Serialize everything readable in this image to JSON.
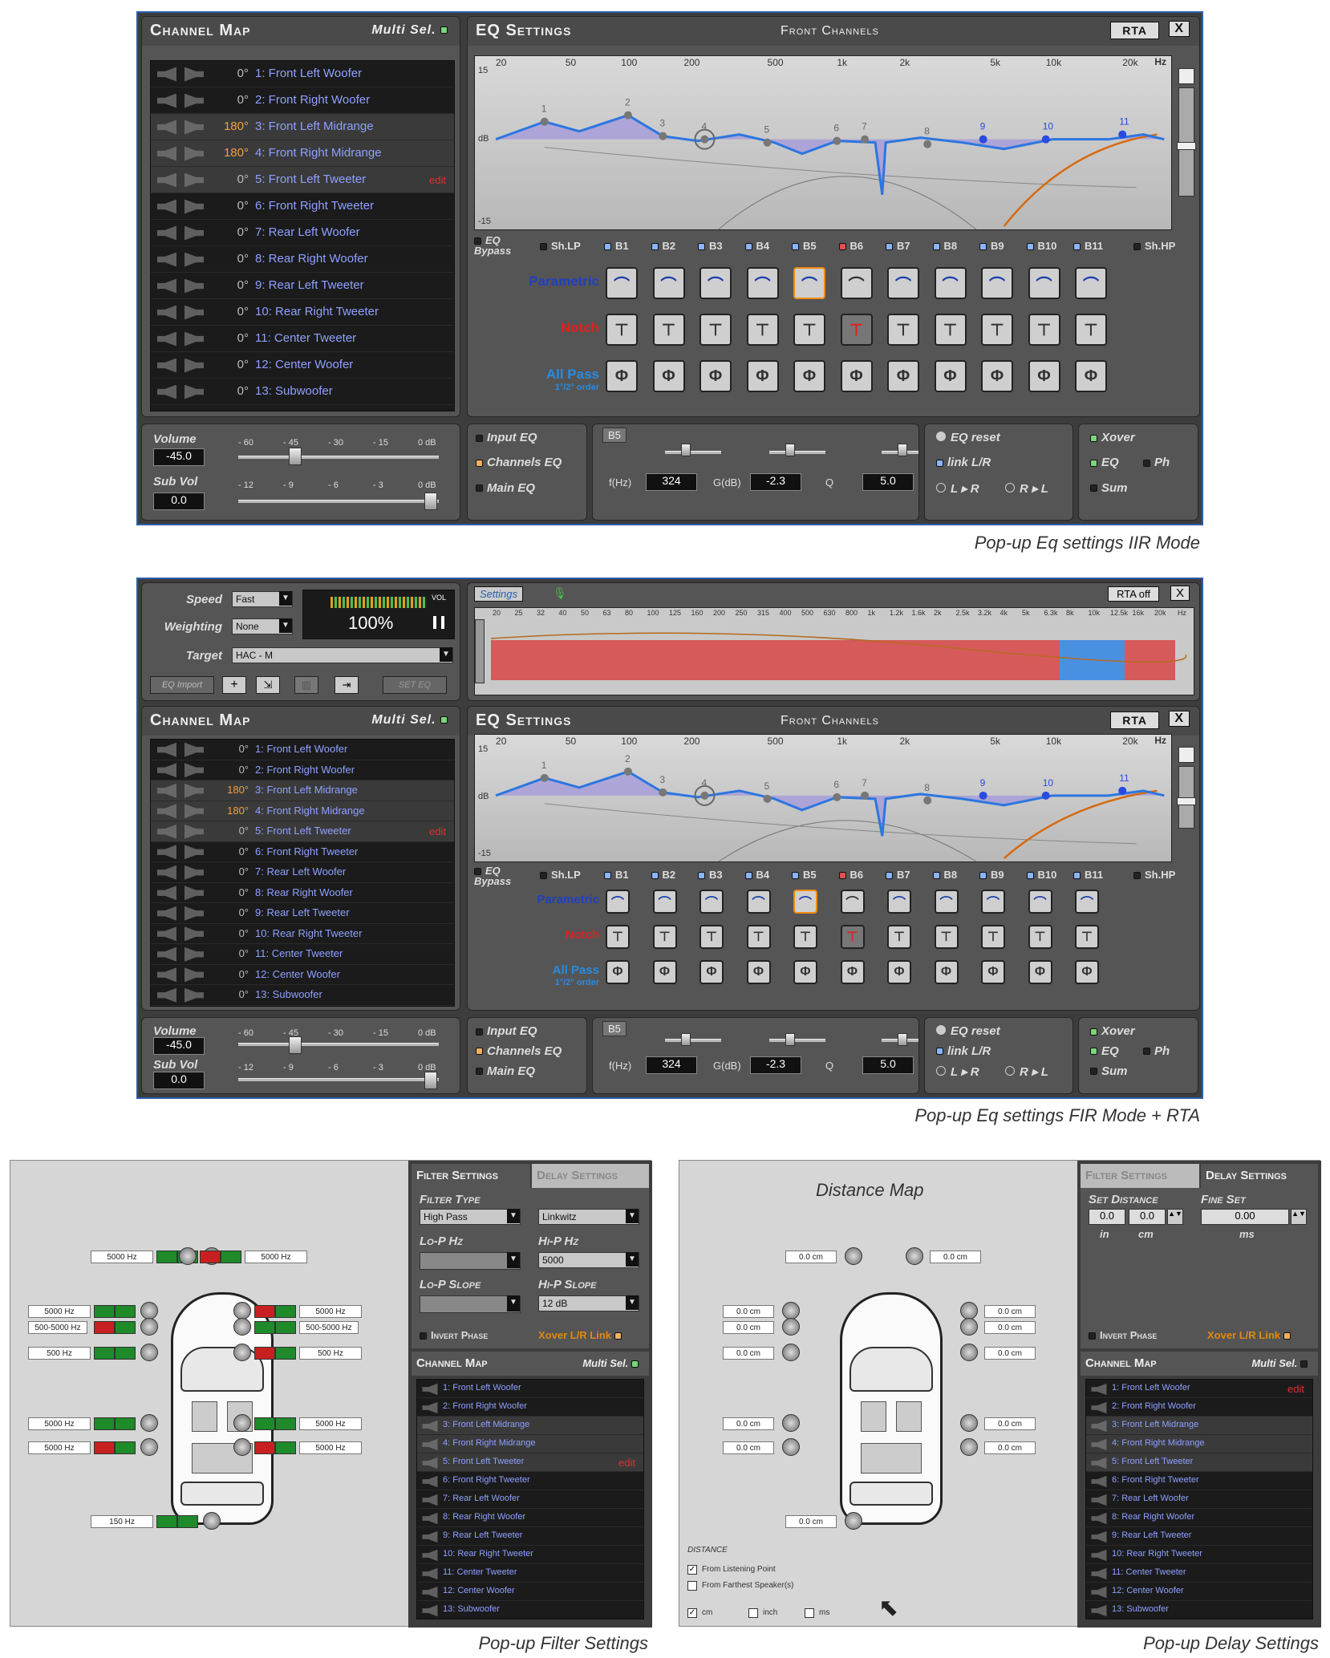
{
  "colors": {
    "panel_border": "#2b5ea8",
    "accent_blue": "#1c3fa8",
    "accent_orange": "#f08a10",
    "notch_red": "#e02020"
  },
  "captions": {
    "iir": "Pop-up Eq settings IIR Mode",
    "fir": "Pop-up Eq settings FIR Mode + RTA",
    "filter": "Pop-up Filter Settings",
    "delay": "Pop-up Delay Settings"
  },
  "channel_map": {
    "title": "Channel Map",
    "multi_sel": "Multi Sel.",
    "edit": "edit",
    "channels": [
      {
        "phase": "0°",
        "name": "1: Front Left Woofer"
      },
      {
        "phase": "0°",
        "name": "2: Front Right Woofer"
      },
      {
        "phase": "180°",
        "name": "3: Front Left Midrange"
      },
      {
        "phase": "180°",
        "name": "4: Front Right Midrange"
      },
      {
        "phase": "0°",
        "name": "5: Front Left Tweeter"
      },
      {
        "phase": "0°",
        "name": "6: Front Right Tweeter"
      },
      {
        "phase": "0°",
        "name": "7: Rear Left Woofer"
      },
      {
        "phase": "0°",
        "name": "8: Rear Right Woofer"
      },
      {
        "phase": "0°",
        "name": "9: Rear Left Tweeter"
      },
      {
        "phase": "0°",
        "name": "10: Rear Right Tweeter"
      },
      {
        "phase": "0°",
        "name": "11: Center Tweeter"
      },
      {
        "phase": "0°",
        "name": "12: Center Woofer"
      },
      {
        "phase": "0°",
        "name": "13: Subwoofer"
      }
    ]
  },
  "eq": {
    "title": "EQ Settings",
    "subtitle": "Front Channels",
    "rta": "RTA",
    "close": "X",
    "freqs": [
      "20",
      "50",
      "100",
      "200",
      "500",
      "1k",
      "2k",
      "5k",
      "10k",
      "20k",
      "Hz"
    ],
    "y_top": "15",
    "y_mid": "dB",
    "y_bot": "-15",
    "bands": [
      "B1",
      "B2",
      "B3",
      "B4",
      "B5",
      "B6",
      "B7",
      "B8",
      "B9",
      "B10",
      "B11"
    ],
    "band_numbers": [
      "1",
      "2",
      "3",
      "4",
      "5",
      "6",
      "7",
      "8",
      "9",
      "10",
      "11"
    ],
    "eq_bypass": "EQ Bypass",
    "sh_lp": "Sh.LP",
    "sh_hp": "Sh.HP",
    "parametric": "Parametric",
    "notch": "Notch",
    "all_pass": "All Pass",
    "all_pass_sub": "1°/2° order",
    "phase_symbol": "Φ",
    "input_eq": "Input EQ",
    "channels_eq": "Channels EQ",
    "main_eq": "Main EQ",
    "band_sel": "B5",
    "f_label": "f(Hz)",
    "f_val": "324",
    "g_label": "G(dB)",
    "g_val": "-2.3",
    "q_label": "Q",
    "q_val": "5.0",
    "eq_reset": "EQ reset",
    "link": "link L/R",
    "lr": "L ▸ R",
    "rl": "R ▸ L",
    "xover": "Xover",
    "eq_btn": "EQ",
    "ph": "Ph",
    "sum": "Sum"
  },
  "volume": {
    "label": "Volume",
    "value": "-45.0",
    "scale": [
      "- 60",
      "- 45",
      "- 30",
      "- 15",
      "0 dB"
    ],
    "sub_label": "Sub Vol",
    "sub_value": "0.0",
    "sub_scale": [
      "- 12",
      "- 9",
      "- 6",
      "- 3",
      "0 dB"
    ]
  },
  "rta_panel": {
    "speed_label": "Speed",
    "speed": "Fast",
    "weighting_label": "Weighting",
    "weighting": "None",
    "target_label": "Target",
    "target": "HAC - M",
    "meter": "100%",
    "vol": "VOL",
    "eq_import": "EQ Import",
    "set_eq": "SET EQ",
    "settings": "Settings",
    "rta_off": "RTA off",
    "freqs": [
      "20",
      "25",
      "32",
      "40",
      "50",
      "63",
      "80",
      "100",
      "125",
      "160",
      "200",
      "250",
      "315",
      "400",
      "500",
      "630",
      "800",
      "1k",
      "1.2k",
      "1.6k",
      "2k",
      "2.5k",
      "3.2k",
      "4k",
      "5k",
      "6.3k",
      "8k",
      "10k",
      "12.5k",
      "16k",
      "20k",
      "Hz"
    ]
  },
  "filter": {
    "tab1": "Filter Settings",
    "tab2": "Delay Settings",
    "type_label": "Filter Type",
    "type": "High Pass",
    "kind": "Linkwitz",
    "lop": "Lo-P Hz",
    "hip": "Hi-P Hz",
    "hip_val": "5000",
    "lop_slope": "Lo-P Slope",
    "hip_slope": "Hi-P Slope",
    "hip_slope_val": "12 dB",
    "invert": "Invert Phase",
    "xover_link": "Xover L/R Link",
    "hz": {
      "top_l": "5000 Hz",
      "top_r": "5000 Hz",
      "l1": "5000 Hz",
      "l2": "500-5000 Hz",
      "l3": "500 Hz",
      "r1": "5000 Hz",
      "r2": "500-5000 Hz",
      "r3": "500 Hz",
      "l4": "5000 Hz",
      "l5": "5000 Hz",
      "r4": "5000 Hz",
      "r5": "5000 Hz",
      "sub": "150 Hz"
    }
  },
  "delay": {
    "title": "Distance Map",
    "set_distance": "Set Distance",
    "fine_set": "Fine Set",
    "d1": "0.0",
    "d2": "0.0",
    "fine": "0.00",
    "in": "in",
    "cm": "cm",
    "ms": "ms",
    "cm_val": "0.0 cm",
    "distance": "DISTANCE",
    "from_lp": "From Listening Point",
    "from_fs": "From Farthest Speaker(s)",
    "unit_cm": "cm",
    "unit_inch": "inch",
    "unit_ms": "ms"
  }
}
